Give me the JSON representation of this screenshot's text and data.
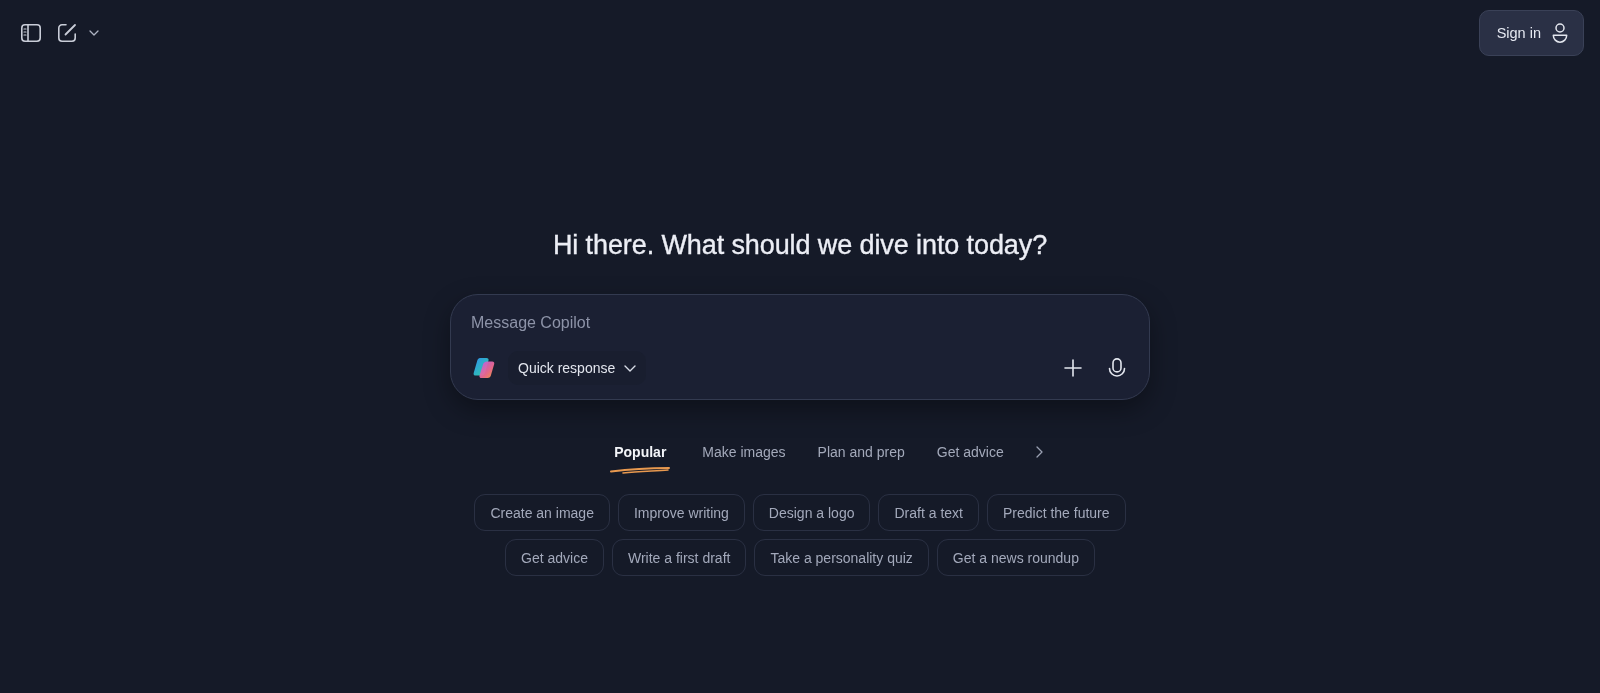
{
  "header": {
    "sign_in_button": "Sign in"
  },
  "greeting": "Hi there. What should we dive into today?",
  "composer": {
    "placeholder": "Message Copilot",
    "mode_button": "Quick response"
  },
  "tabs": [
    {
      "label": "Popular",
      "selected": true
    },
    {
      "label": "Make images",
      "selected": false
    },
    {
      "label": "Plan and prep",
      "selected": false
    },
    {
      "label": "Get advice",
      "selected": false
    }
  ],
  "suggestions": [
    [
      "Create an image",
      "Improve writing",
      "Design a logo",
      "Draft a text",
      "Predict the future"
    ],
    [
      "Get advice",
      "Write a first draft",
      "Take a personality quiz",
      "Get a news roundup"
    ]
  ]
}
